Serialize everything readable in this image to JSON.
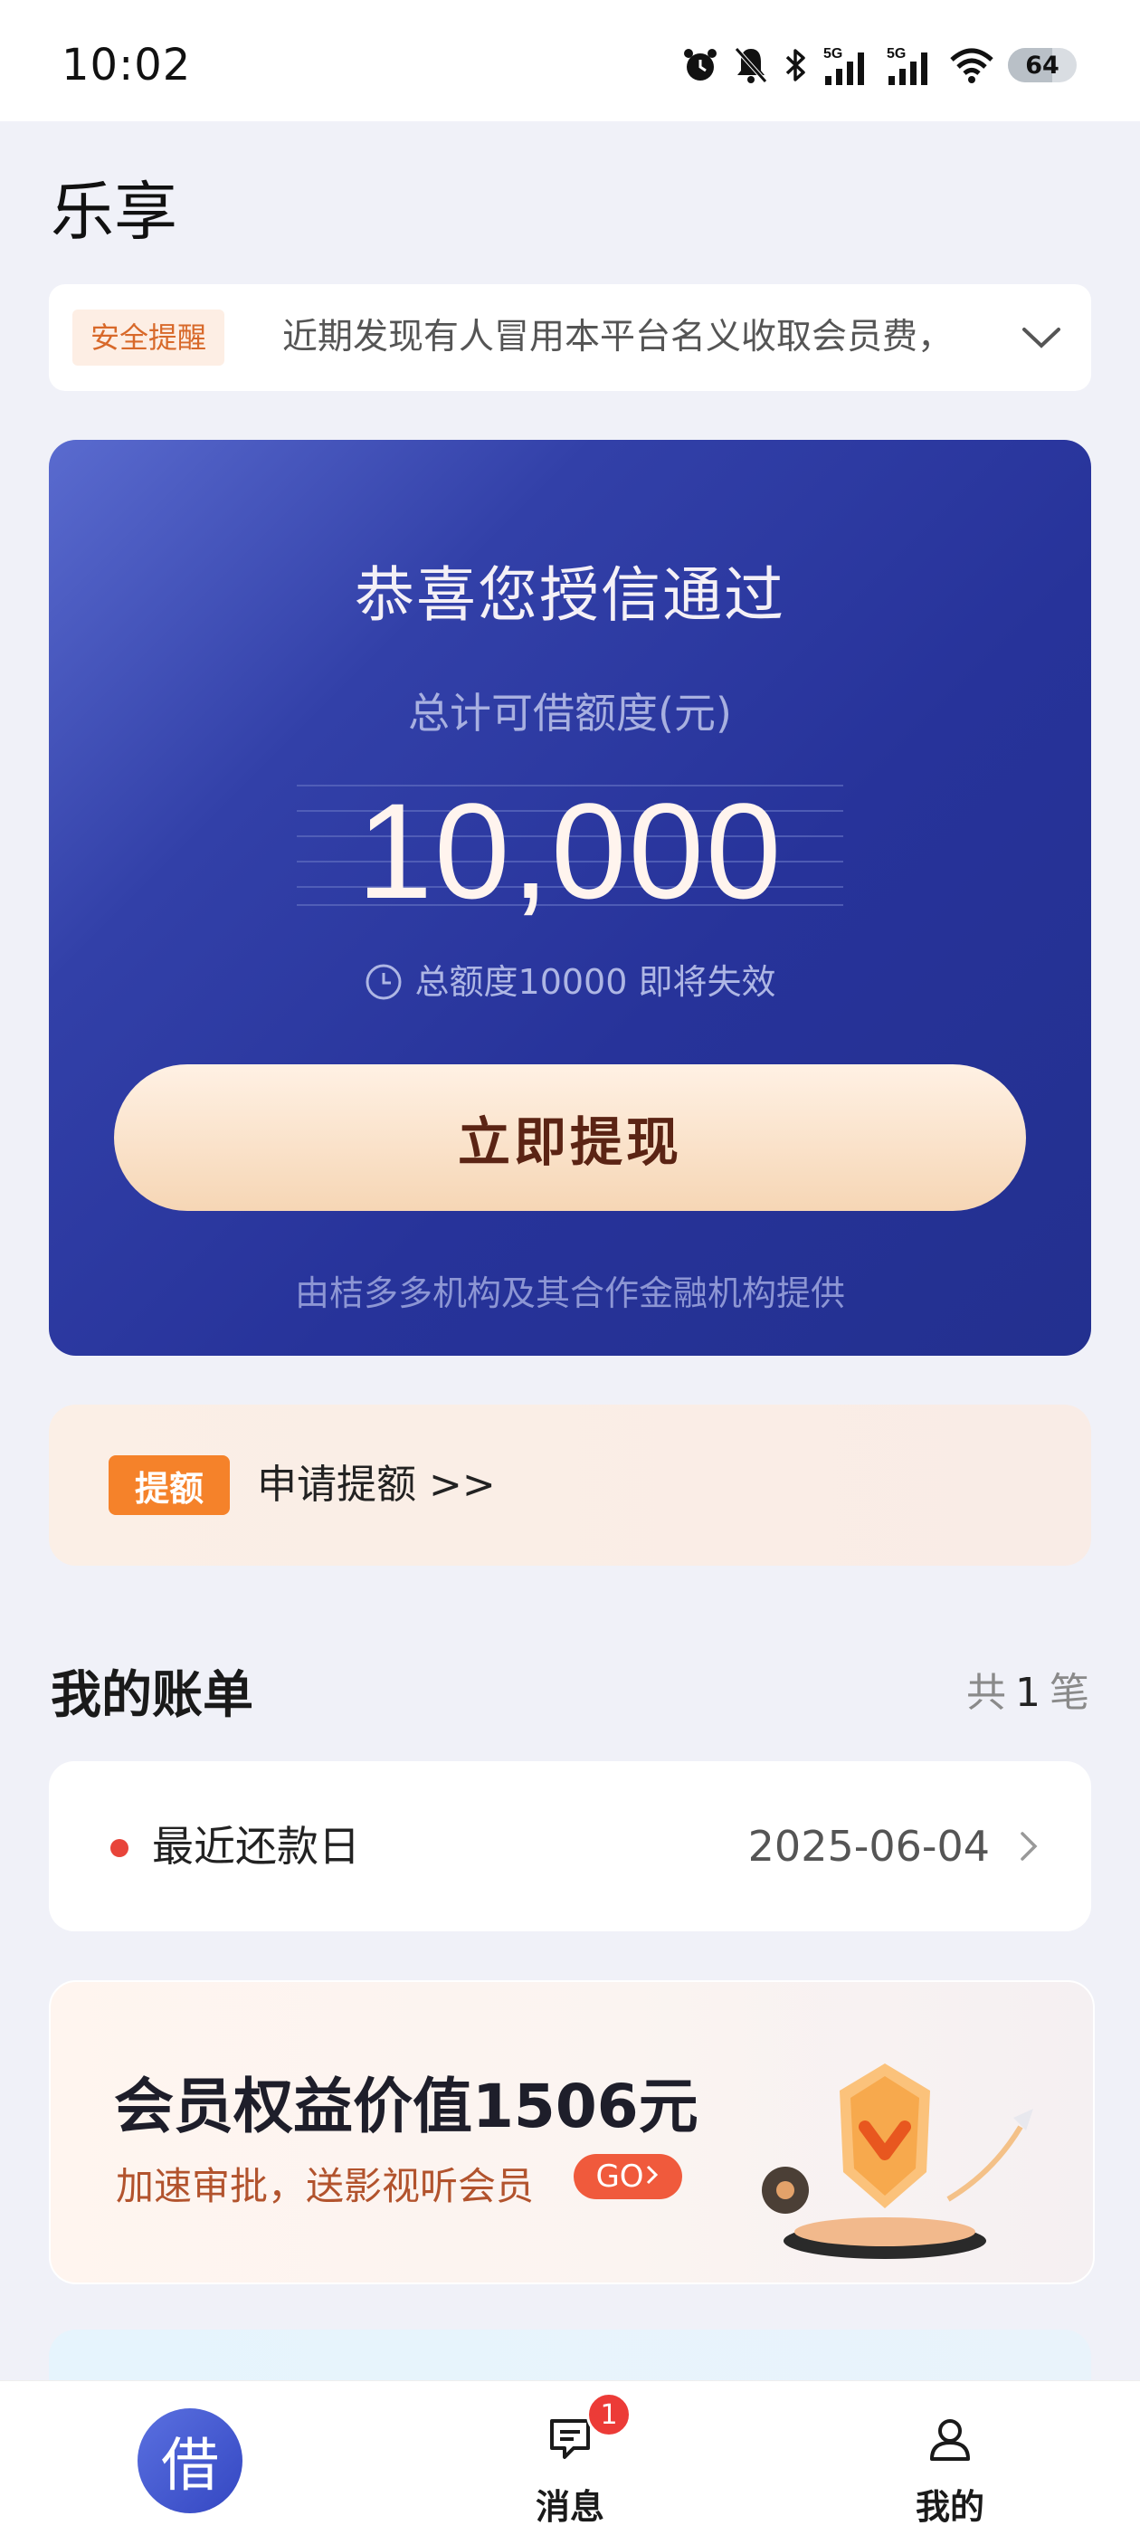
{
  "status_bar": {
    "time": "10:02",
    "network_1": "5G",
    "network_2": "5G",
    "battery_level": 64
  },
  "header": {
    "title": "乐享"
  },
  "notice": {
    "tag": "安全提醒",
    "message": "近期发现有人冒用本平台名义收取会员费，"
  },
  "credit": {
    "title": "恭喜您授信通过",
    "subtitle": "总计可借额度(元)",
    "amount": "10,000",
    "expire_text": "总额度10000 即将失效",
    "withdraw_label": "立即提现",
    "provider_text": "由桔多多机构及其合作金融机构提供"
  },
  "raise_limit": {
    "badge": "提额",
    "text": "申请提额 >>"
  },
  "bills": {
    "heading": "我的账单",
    "count_prefix": "共",
    "count": "1",
    "count_suffix": "笔",
    "row_label": "最近还款日",
    "row_date": "2025-06-04"
  },
  "member": {
    "headline": "会员权益价值1506元",
    "subline": "加速审批，送影视听会员",
    "go_label": "GO"
  },
  "tabbar": {
    "borrow_label": "借",
    "message_label": "消息",
    "message_badge": "1",
    "mine_label": "我的"
  },
  "colors": {
    "card_primary": "#27339a",
    "accent_orange": "#f5822a",
    "withdraw_text": "#5b2414",
    "alert_red": "#e8443a"
  }
}
